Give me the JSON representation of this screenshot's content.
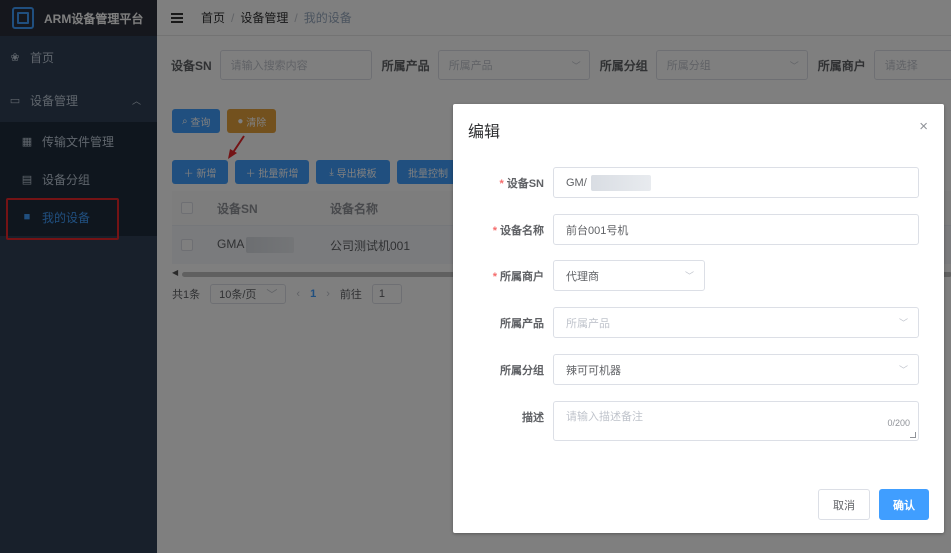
{
  "app": {
    "title": "ARM设备管理平台"
  },
  "sidebar": {
    "items": [
      {
        "label": "首页"
      },
      {
        "label": "设备管理"
      }
    ],
    "sub_items": [
      {
        "label": "传输文件管理"
      },
      {
        "label": "设备分组"
      },
      {
        "label": "我的设备"
      }
    ]
  },
  "breadcrumb": {
    "home": "首页",
    "sep": "/",
    "mid": "设备管理",
    "current": "我的设备"
  },
  "filters": {
    "sn_label": "设备SN",
    "sn_placeholder": "请输入搜索内容",
    "product_label": "所属产品",
    "product_placeholder": "所属产品",
    "group_label": "所属分组",
    "group_placeholder": "所属分组",
    "merchant_label": "所属商户",
    "merchant_placeholder": "请选择"
  },
  "actions": {
    "query": "查询",
    "clear": "清除",
    "add": "新增",
    "batch_add": "批量新增",
    "export_template": "导出模板",
    "batch_control": "批量控制"
  },
  "table": {
    "columns": [
      "设备SN",
      "设备名称"
    ],
    "rows": [
      {
        "sn": "GMA",
        "name": "公司测试机001"
      }
    ]
  },
  "pagination": {
    "total": "共1条",
    "page_size": "10条/页",
    "page": "1",
    "goto_label": "前往",
    "goto_value": "1"
  },
  "dialog": {
    "title": "编辑",
    "fields": {
      "sn_label": "设备SN",
      "sn_value": "GM/",
      "name_label": "设备名称",
      "name_value": "前台001号机",
      "merchant_label": "所属商户",
      "merchant_value": "代理商",
      "product_label": "所属产品",
      "product_placeholder": "所属产品",
      "group_label": "所属分组",
      "group_value": "辣可可机器",
      "desc_label": "描述",
      "desc_placeholder": "请输入描述备注",
      "desc_counter": "0/200"
    },
    "cancel": "取消",
    "confirm": "确认"
  },
  "colors": {
    "primary": "#409eff",
    "warning": "#e6a23c",
    "sidebar": "#304156",
    "annotation": "#e8262a"
  }
}
